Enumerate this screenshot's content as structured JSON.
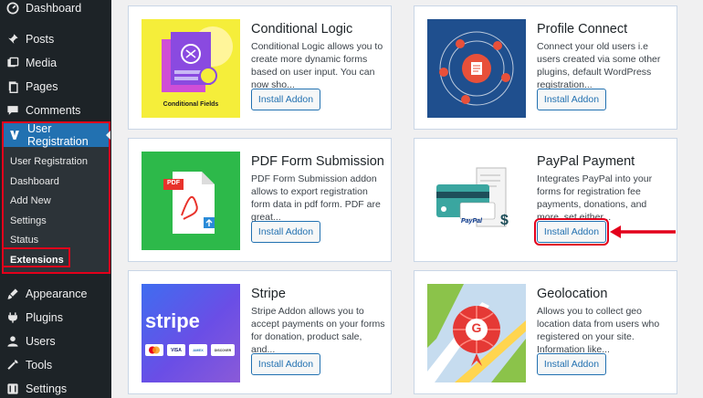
{
  "sidebar": {
    "top_items": [
      {
        "label": "Dashboard",
        "icon": "dashboard-icon"
      },
      {
        "label": "Posts",
        "icon": "pin-icon"
      },
      {
        "label": "Media",
        "icon": "media-icon"
      },
      {
        "label": "Pages",
        "icon": "pages-icon"
      },
      {
        "label": "Comments",
        "icon": "comment-icon"
      }
    ],
    "active_menu": {
      "label": "User Registration",
      "icon": "user-registration-icon"
    },
    "submenu": [
      "User Registration",
      "Dashboard",
      "Add New",
      "Settings",
      "Status",
      "Extensions"
    ],
    "bottom_items": [
      {
        "label": "Appearance",
        "icon": "brush-icon"
      },
      {
        "label": "Plugins",
        "icon": "plug-icon"
      },
      {
        "label": "Users",
        "icon": "users-icon"
      },
      {
        "label": "Tools",
        "icon": "wrench-icon"
      },
      {
        "label": "Settings",
        "icon": "settings-icon"
      }
    ]
  },
  "addons": [
    {
      "title": "Conditional Logic",
      "desc": "Conditional Logic allows you to create more dynamic forms based on user input. You can now sho...",
      "button": "Install Addon",
      "thumb_label": "Conditional Fields"
    },
    {
      "title": "Profile Connect",
      "desc": "Connect your old users i.e users created via some other plugins, default WordPress registration...",
      "button": "Install Addon"
    },
    {
      "title": "PDF Form Submission",
      "desc": "PDF Form Submission addon allows to export registration form data in pdf form. PDF are great...",
      "button": "Install Addon",
      "thumb_label": "PDF"
    },
    {
      "title": "PayPal Payment",
      "desc": "Integrates PayPal into your forms for registration fee payments, donations, and more. set either...",
      "button": "Install Addon",
      "thumb_label": "PayPal"
    },
    {
      "title": "Stripe",
      "desc": "Stripe Addon allows you to accept payments on your forms for donation, product sale, and...",
      "button": "Install Addon",
      "thumb_label": "stripe",
      "card_labels": [
        "VISA",
        "AMEX",
        "DISCOVER"
      ]
    },
    {
      "title": "Geolocation",
      "desc": "Allows you to collect geo location data from users who registered on your site. Information like...",
      "button": "Install Addon",
      "thumb_label": "G"
    }
  ],
  "colors": {
    "sidebar_bg": "#1d2327",
    "accent": "#2271b1",
    "highlight": "#e3001b"
  }
}
